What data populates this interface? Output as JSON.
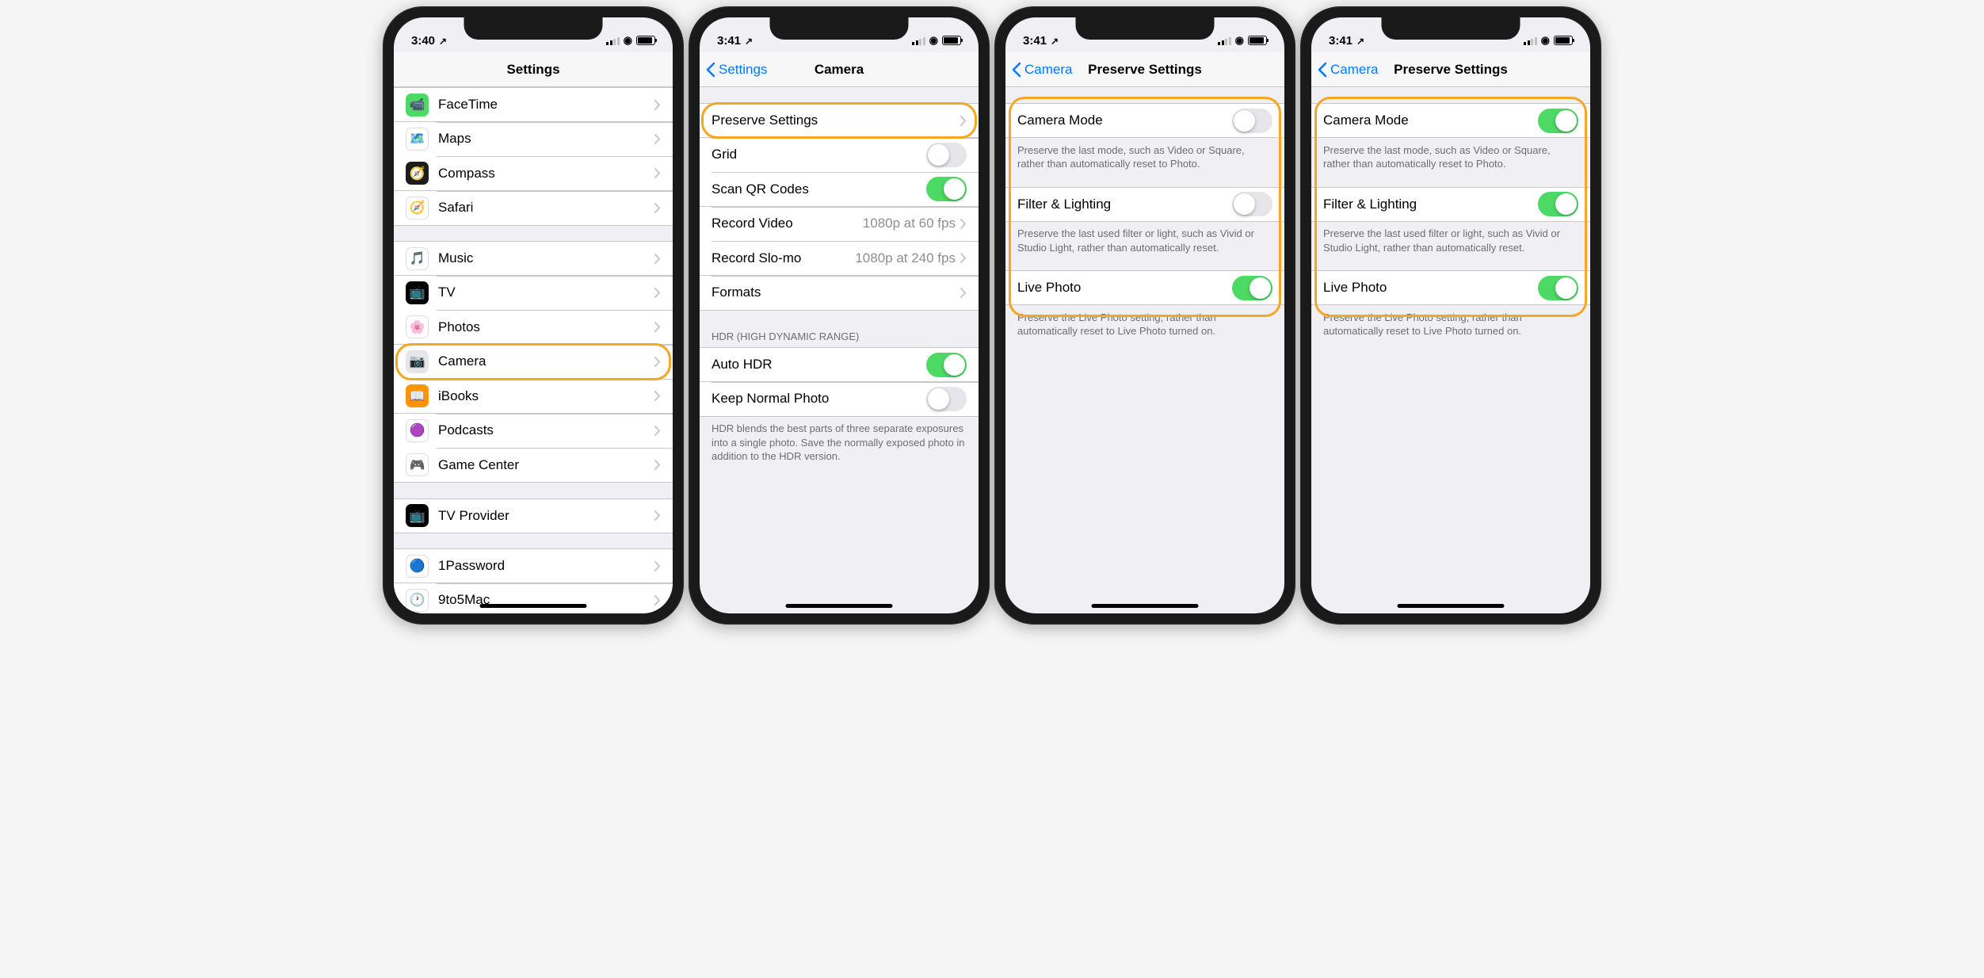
{
  "status": {
    "time1": "3:40",
    "time2": "3:41"
  },
  "screens": [
    {
      "title": "Settings",
      "back": null,
      "groups": [
        {
          "items": [
            {
              "icon": "facetime",
              "label": "FaceTime"
            },
            {
              "icon": "maps",
              "label": "Maps"
            },
            {
              "icon": "compass",
              "label": "Compass"
            },
            {
              "icon": "safari",
              "label": "Safari"
            }
          ]
        },
        {
          "items": [
            {
              "icon": "music",
              "label": "Music"
            },
            {
              "icon": "tv",
              "label": "TV"
            },
            {
              "icon": "photos",
              "label": "Photos"
            },
            {
              "icon": "camera",
              "label": "Camera",
              "hl": true
            },
            {
              "icon": "ibooks",
              "label": "iBooks"
            },
            {
              "icon": "podcasts",
              "label": "Podcasts"
            },
            {
              "icon": "gc",
              "label": "Game Center"
            }
          ]
        },
        {
          "items": [
            {
              "icon": "tvp",
              "label": "TV Provider"
            }
          ]
        },
        {
          "items": [
            {
              "icon": "1p",
              "label": "1Password"
            },
            {
              "icon": "9to5",
              "label": "9to5Mac"
            }
          ]
        }
      ]
    },
    {
      "title": "Camera",
      "back": "Settings",
      "groups": [
        {
          "items": [
            {
              "label": "Preserve Settings",
              "chev": true,
              "hl": true
            },
            {
              "label": "Grid",
              "toggle": false
            },
            {
              "label": "Scan QR Codes",
              "toggle": true
            },
            {
              "label": "Record Video",
              "detail": "1080p at 60 fps",
              "chev": true
            },
            {
              "label": "Record Slo-mo",
              "detail": "1080p at 240 fps",
              "chev": true
            },
            {
              "label": "Formats",
              "chev": true
            }
          ]
        },
        {
          "header": "HDR (HIGH DYNAMIC RANGE)",
          "items": [
            {
              "label": "Auto HDR",
              "toggle": true
            },
            {
              "label": "Keep Normal Photo",
              "toggle": false
            }
          ],
          "footer": "HDR blends the best parts of three separate exposures into a single photo. Save the normally exposed photo in addition to the HDR version."
        }
      ]
    },
    {
      "title": "Preserve Settings",
      "back": "Camera",
      "hl_all": true,
      "groups": [
        {
          "items": [
            {
              "label": "Camera Mode",
              "toggle": false
            }
          ],
          "footer": "Preserve the last mode, such as Video or Square, rather than automatically reset to Photo."
        },
        {
          "items": [
            {
              "label": "Filter & Lighting",
              "toggle": false
            }
          ],
          "footer": "Preserve the last used filter or light, such as Vivid or Studio Light, rather than automatically reset."
        },
        {
          "items": [
            {
              "label": "Live Photo",
              "toggle": true
            }
          ],
          "footer": "Preserve the Live Photo setting, rather than automatically reset to Live Photo turned on."
        }
      ]
    },
    {
      "title": "Preserve Settings",
      "back": "Camera",
      "hl_all": true,
      "groups": [
        {
          "items": [
            {
              "label": "Camera Mode",
              "toggle": true
            }
          ],
          "footer": "Preserve the last mode, such as Video or Square, rather than automatically reset to Photo."
        },
        {
          "items": [
            {
              "label": "Filter & Lighting",
              "toggle": true
            }
          ],
          "footer": "Preserve the last used filter or light, such as Vivid or Studio Light, rather than automatically reset."
        },
        {
          "items": [
            {
              "label": "Live Photo",
              "toggle": true
            }
          ],
          "footer": "Preserve the Live Photo setting, rather than automatically reset to Live Photo turned on."
        }
      ]
    }
  ],
  "icons": {
    "facetime": "📹",
    "maps": "🗺️",
    "compass": "🧭",
    "safari": "🧭",
    "music": "🎵",
    "tv": "📺",
    "photos": "🌸",
    "camera": "📷",
    "ibooks": "📖",
    "podcasts": "🟣",
    "gc": "🎮",
    "tvp": "📺",
    "1p": "🔵",
    "9to5": "🕐"
  }
}
